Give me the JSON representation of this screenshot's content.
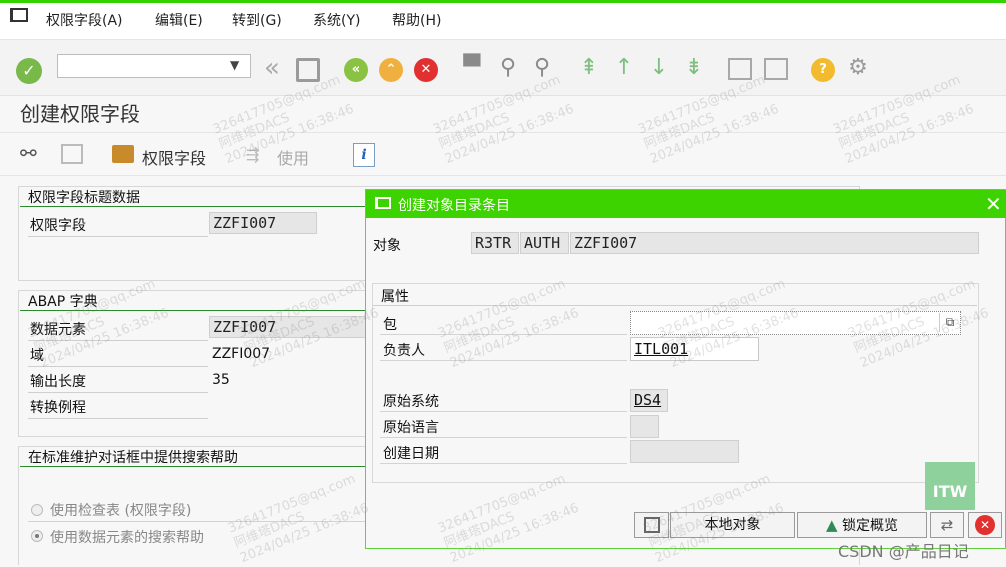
{
  "menu": {
    "items": [
      "权限字段(A)",
      "编辑(E)",
      "转到(G)",
      "系统(Y)",
      "帮助(H)"
    ]
  },
  "page": {
    "title": "创建权限字段"
  },
  "subtoolbar": {
    "auth_field_label": "权限字段",
    "usage_label": "使用",
    "info_label": "i"
  },
  "header_group": {
    "title": "权限字段标题数据",
    "rows": [
      {
        "label": "权限字段",
        "value": "ZZFI007"
      }
    ]
  },
  "abap_group": {
    "title": "ABAP 字典",
    "rows": [
      {
        "label": "数据元素",
        "value": "ZZFI007"
      },
      {
        "label": "域",
        "value": "ZZFI007"
      },
      {
        "label": "输出长度",
        "value": "35"
      },
      {
        "label": "转换例程",
        "value": ""
      }
    ]
  },
  "search_group": {
    "title": "在标准维护对话框中提供搜索帮助",
    "options": [
      {
        "label": "使用检查表 (权限字段)",
        "selected": false
      },
      {
        "label": "使用数据元素的搜索帮助",
        "selected": true
      }
    ]
  },
  "dialog": {
    "title": "创建对象目录条目",
    "object_label": "对象",
    "object_values": [
      "R3TR",
      "AUTH",
      "ZZFI007"
    ],
    "attributes_title": "属性",
    "package_label": "包",
    "package_value": "",
    "owner_label": "负责人",
    "owner_value": "ITL001",
    "orig_system_label": "原始系统",
    "orig_system_value": "DS4",
    "orig_lang_label": "原始语言",
    "orig_lang_value": "",
    "created_label": "创建日期",
    "created_value": "",
    "buttons": {
      "local_object": "本地对象",
      "lock_overview": "锁定概览"
    }
  },
  "watermark": {
    "line1": "326417705@qq.com",
    "line2": "阿维塔DACS",
    "line3": "2024/04/25 16:38:46"
  },
  "corner": {
    "itw": "ITW",
    "csdn": "CSDN @产品日记"
  },
  "colors": {
    "accent_green": "#3dd300",
    "ok_green": "#78b94a",
    "nav_green": "#8ac243",
    "nav_orange": "#f0b040",
    "cancel_red": "#e03030",
    "help_yellow": "#f2bb2e"
  }
}
